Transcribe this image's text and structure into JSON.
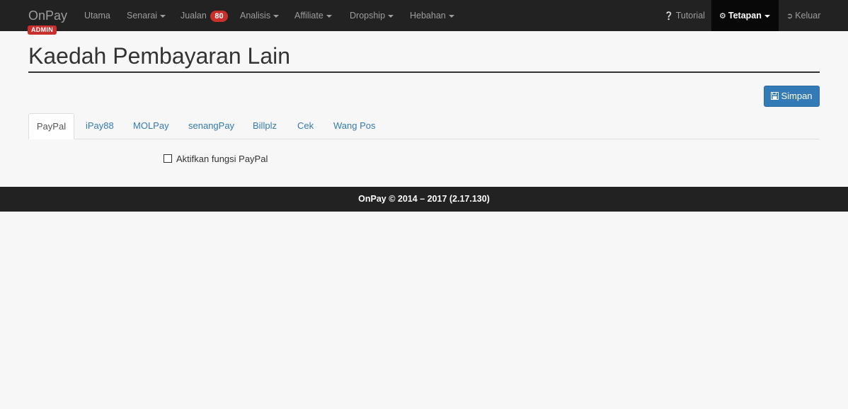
{
  "navbar": {
    "brand": "OnPay",
    "brand_badge": "ADMIN",
    "items": [
      {
        "label": "Utama"
      },
      {
        "label": "Senarai"
      },
      {
        "label": "Jualan",
        "badge": "80"
      },
      {
        "label": "Analisis"
      },
      {
        "label": "Affiliate"
      },
      {
        "label": "Dropship"
      },
      {
        "label": "Hebahan"
      }
    ],
    "right": [
      {
        "label": "Tutorial",
        "icon": "question-circle-icon"
      },
      {
        "label": "Tetapan",
        "icon": "gears-icon"
      },
      {
        "label": "Keluar",
        "icon": "sign-out-icon"
      }
    ]
  },
  "page": {
    "title": "Kaedah Pembayaran Lain",
    "save_label": "Simpan",
    "save_icon": "floppy-disk-icon"
  },
  "tabs": [
    "PayPal",
    "iPay88",
    "MOLPay",
    "senangPay",
    "Billplz",
    "Cek",
    "Wang Pos"
  ],
  "active_tab": "PayPal",
  "paypal": {
    "enable_label": "Aktifkan fungsi PayPal",
    "enabled": false
  },
  "footer": {
    "text": "OnPay © 2014 – 2017 (2.17.130)"
  },
  "colors": {
    "navbar_bg": "#222222",
    "primary": "#337ab7",
    "danger_badge": "#c9302c"
  }
}
